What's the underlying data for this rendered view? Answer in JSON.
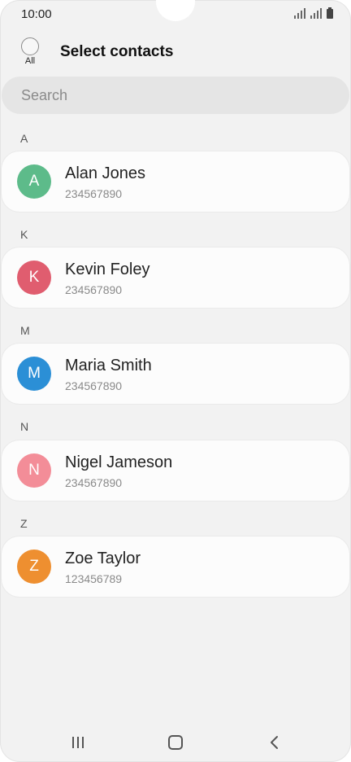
{
  "status_bar": {
    "time": "10:00"
  },
  "header": {
    "all_label": "All",
    "title": "Select contacts"
  },
  "search": {
    "placeholder": "Search",
    "value": ""
  },
  "sections": [
    {
      "letter": "A",
      "contact": {
        "initial": "A",
        "name": "Alan Jones",
        "number": "234567890",
        "color": "#5dbb8a"
      }
    },
    {
      "letter": "K",
      "contact": {
        "initial": "K",
        "name": "Kevin Foley",
        "number": "234567890",
        "color": "#e05d6f"
      }
    },
    {
      "letter": "M",
      "contact": {
        "initial": "M",
        "name": "Maria Smith",
        "number": "234567890",
        "color": "#2b8fd6"
      }
    },
    {
      "letter": "N",
      "contact": {
        "initial": "N",
        "name": "Nigel Jameson",
        "number": "234567890",
        "color": "#f38d98"
      }
    },
    {
      "letter": "Z",
      "contact": {
        "initial": "Z",
        "name": "Zoe Taylor",
        "number": "123456789",
        "color": "#ee8f30"
      }
    }
  ],
  "nav_bar": {
    "icons": [
      "recents-icon",
      "home-icon",
      "back-icon"
    ]
  }
}
